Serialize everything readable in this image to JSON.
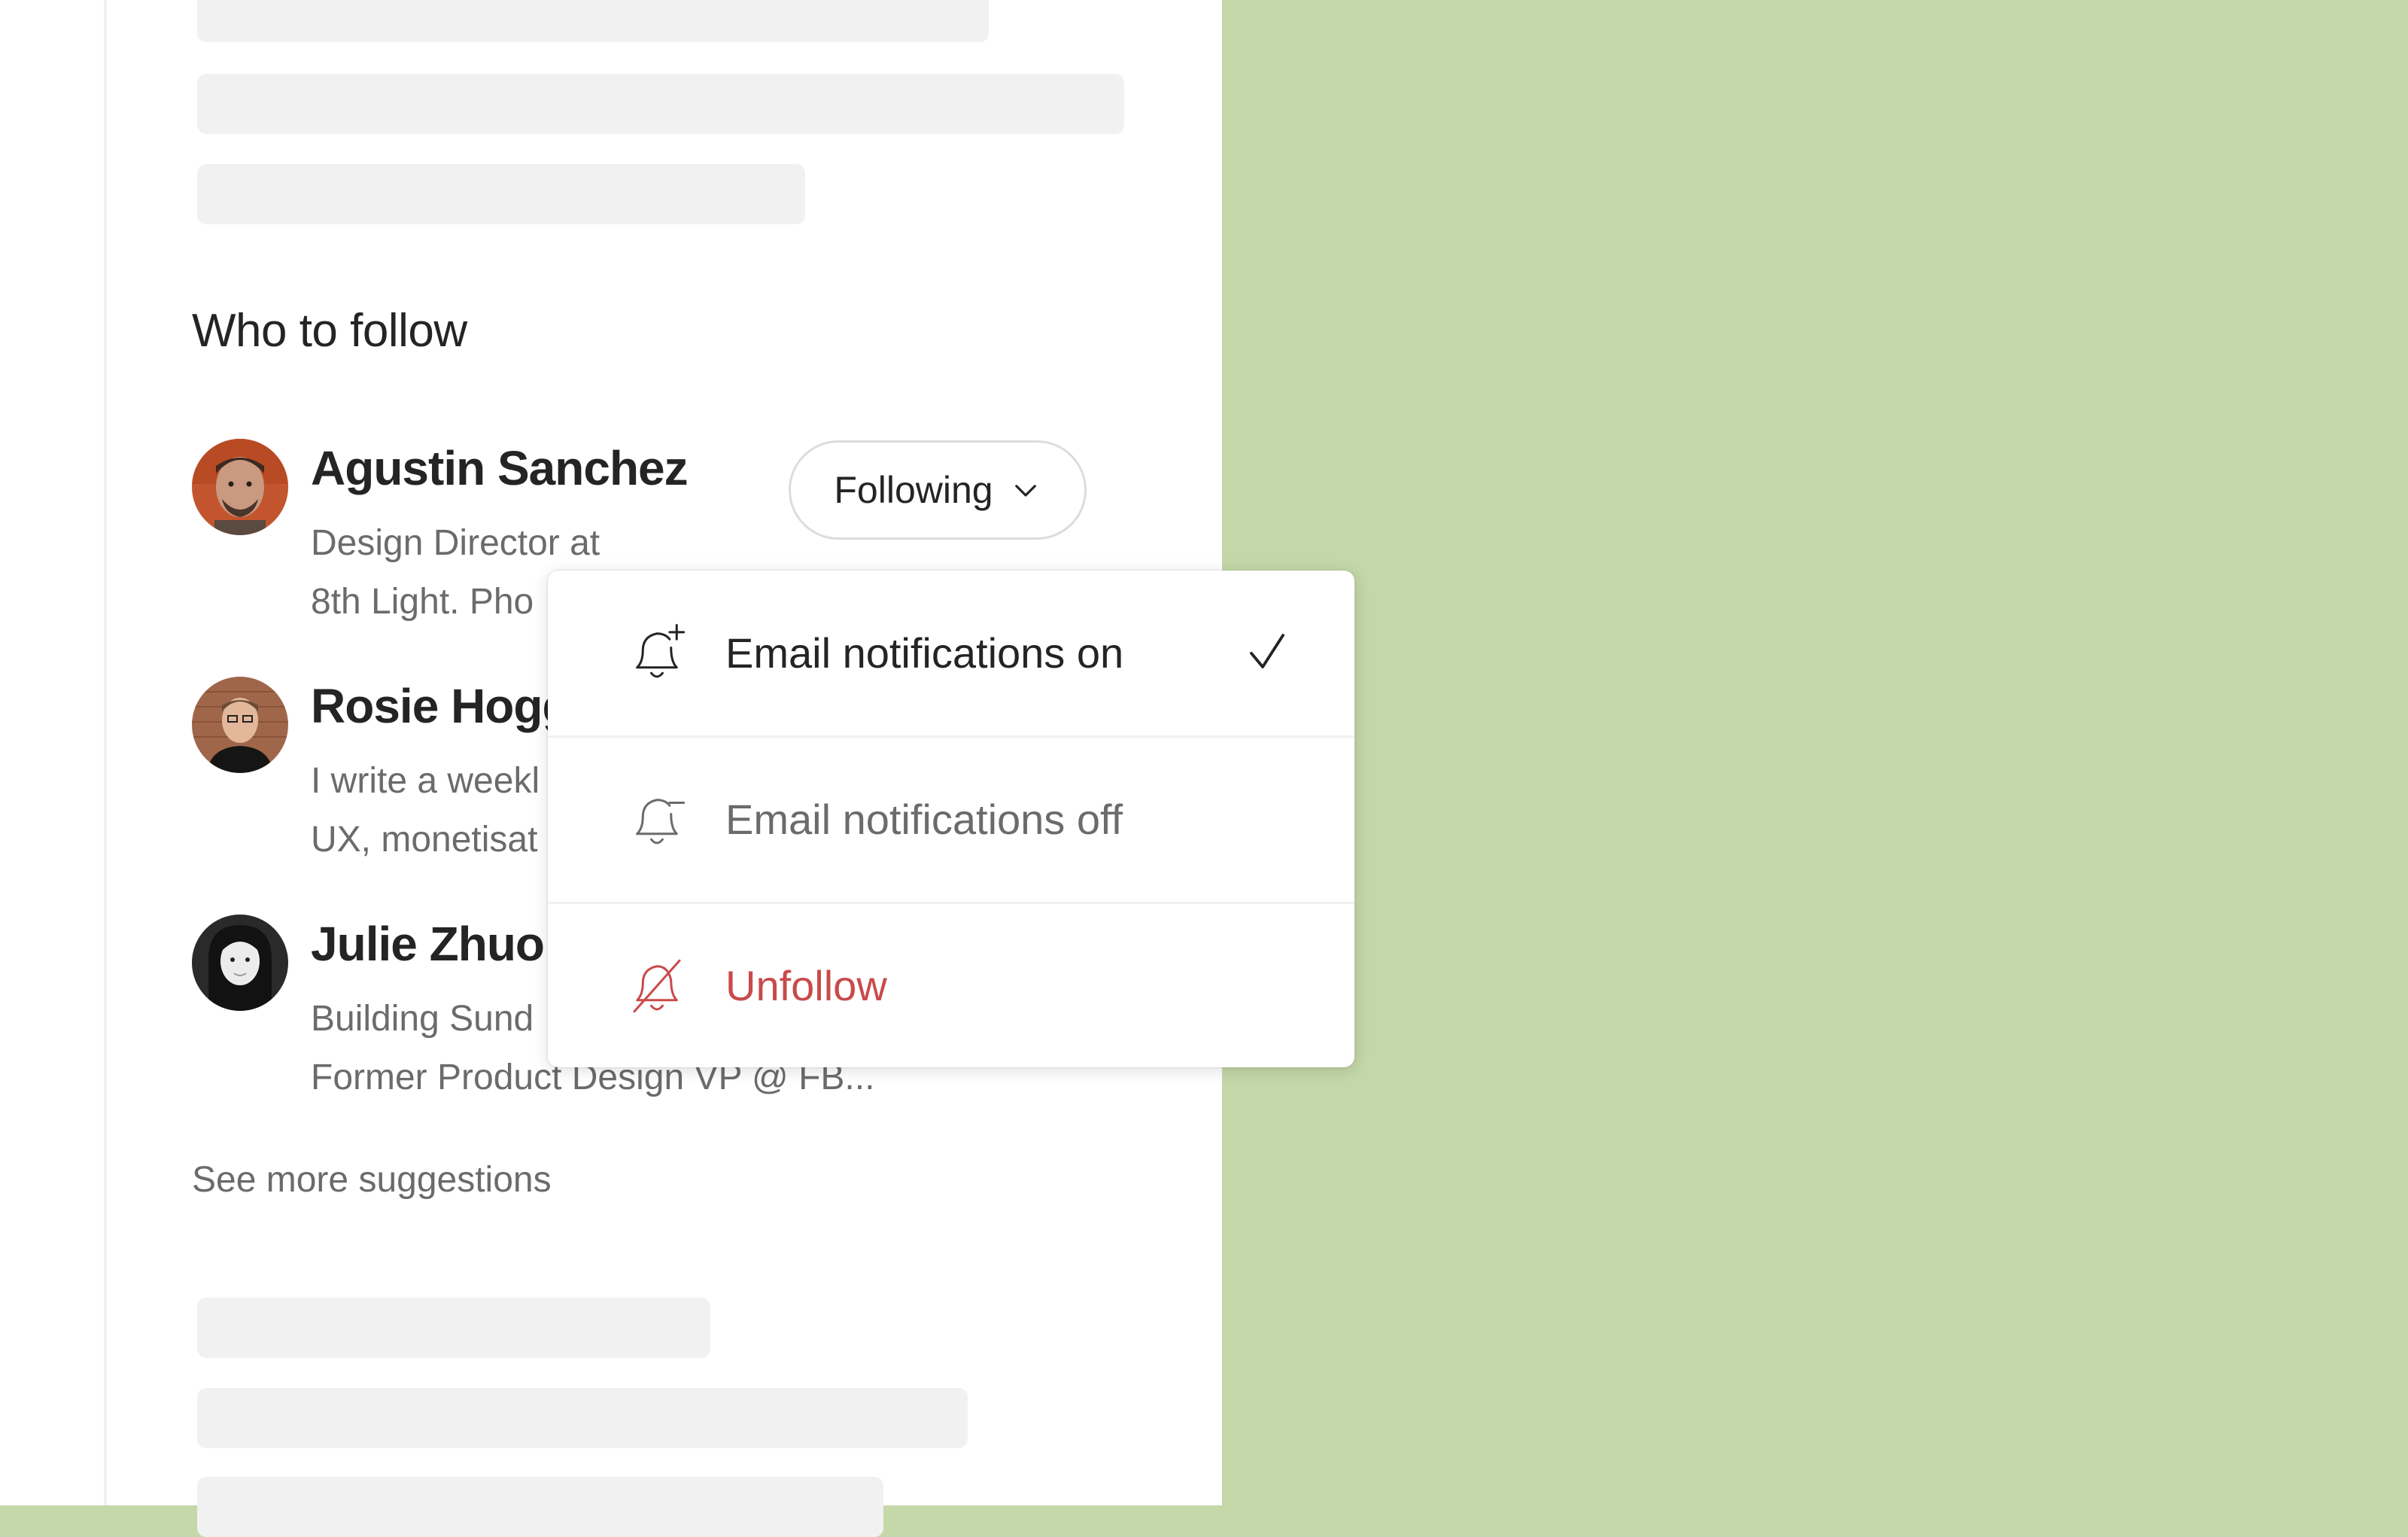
{
  "sidebar": {
    "section_title": "Who to follow",
    "people": [
      {
        "name": "Agustin Sanchez",
        "bio_line1": "Design Director at",
        "bio_line2": "8th Light. Pho"
      },
      {
        "name": "Rosie Hogg",
        "bio_line1": "I write a weekl",
        "bio_line2": "UX, monetisat"
      },
      {
        "name": "Julie Zhuo",
        "bio_line1": "Building Sund",
        "bio_line2": "Former Product Design VP @ FB..."
      }
    ],
    "following_button": "Following",
    "see_more": "See more suggestions"
  },
  "menu": {
    "items": [
      {
        "label": "Email notifications on",
        "icon": "bell-plus-icon",
        "checked": true,
        "color": "#242424"
      },
      {
        "label": "Email notifications off",
        "icon": "bell-minus-icon",
        "checked": false,
        "color": "#6b6b6b"
      },
      {
        "label": "Unfollow",
        "icon": "bell-off-icon",
        "checked": false,
        "color": "#c94a4a"
      }
    ]
  },
  "colors": {
    "background": "#c3d7a8",
    "panel": "#ffffff",
    "skeleton": "#f1f1f1",
    "danger": "#c94a4a"
  }
}
